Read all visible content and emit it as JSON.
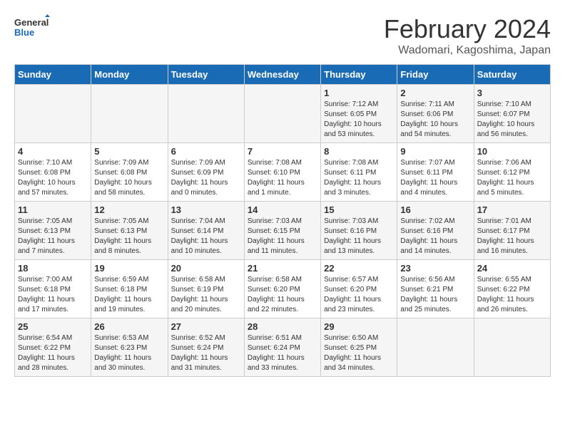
{
  "logo": {
    "line1": "General",
    "line2": "Blue"
  },
  "title": "February 2024",
  "subtitle": "Wadomari, Kagoshima, Japan",
  "days_of_week": [
    "Sunday",
    "Monday",
    "Tuesday",
    "Wednesday",
    "Thursday",
    "Friday",
    "Saturday"
  ],
  "weeks": [
    [
      {
        "day": "",
        "info": ""
      },
      {
        "day": "",
        "info": ""
      },
      {
        "day": "",
        "info": ""
      },
      {
        "day": "",
        "info": ""
      },
      {
        "day": "1",
        "info": "Sunrise: 7:12 AM\nSunset: 6:05 PM\nDaylight: 10 hours\nand 53 minutes."
      },
      {
        "day": "2",
        "info": "Sunrise: 7:11 AM\nSunset: 6:06 PM\nDaylight: 10 hours\nand 54 minutes."
      },
      {
        "day": "3",
        "info": "Sunrise: 7:10 AM\nSunset: 6:07 PM\nDaylight: 10 hours\nand 56 minutes."
      }
    ],
    [
      {
        "day": "4",
        "info": "Sunrise: 7:10 AM\nSunset: 6:08 PM\nDaylight: 10 hours\nand 57 minutes."
      },
      {
        "day": "5",
        "info": "Sunrise: 7:09 AM\nSunset: 6:08 PM\nDaylight: 10 hours\nand 58 minutes."
      },
      {
        "day": "6",
        "info": "Sunrise: 7:09 AM\nSunset: 6:09 PM\nDaylight: 11 hours\nand 0 minutes."
      },
      {
        "day": "7",
        "info": "Sunrise: 7:08 AM\nSunset: 6:10 PM\nDaylight: 11 hours\nand 1 minute."
      },
      {
        "day": "8",
        "info": "Sunrise: 7:08 AM\nSunset: 6:11 PM\nDaylight: 11 hours\nand 3 minutes."
      },
      {
        "day": "9",
        "info": "Sunrise: 7:07 AM\nSunset: 6:11 PM\nDaylight: 11 hours\nand 4 minutes."
      },
      {
        "day": "10",
        "info": "Sunrise: 7:06 AM\nSunset: 6:12 PM\nDaylight: 11 hours\nand 5 minutes."
      }
    ],
    [
      {
        "day": "11",
        "info": "Sunrise: 7:05 AM\nSunset: 6:13 PM\nDaylight: 11 hours\nand 7 minutes."
      },
      {
        "day": "12",
        "info": "Sunrise: 7:05 AM\nSunset: 6:13 PM\nDaylight: 11 hours\nand 8 minutes."
      },
      {
        "day": "13",
        "info": "Sunrise: 7:04 AM\nSunset: 6:14 PM\nDaylight: 11 hours\nand 10 minutes."
      },
      {
        "day": "14",
        "info": "Sunrise: 7:03 AM\nSunset: 6:15 PM\nDaylight: 11 hours\nand 11 minutes."
      },
      {
        "day": "15",
        "info": "Sunrise: 7:03 AM\nSunset: 6:16 PM\nDaylight: 11 hours\nand 13 minutes."
      },
      {
        "day": "16",
        "info": "Sunrise: 7:02 AM\nSunset: 6:16 PM\nDaylight: 11 hours\nand 14 minutes."
      },
      {
        "day": "17",
        "info": "Sunrise: 7:01 AM\nSunset: 6:17 PM\nDaylight: 11 hours\nand 16 minutes."
      }
    ],
    [
      {
        "day": "18",
        "info": "Sunrise: 7:00 AM\nSunset: 6:18 PM\nDaylight: 11 hours\nand 17 minutes."
      },
      {
        "day": "19",
        "info": "Sunrise: 6:59 AM\nSunset: 6:18 PM\nDaylight: 11 hours\nand 19 minutes."
      },
      {
        "day": "20",
        "info": "Sunrise: 6:58 AM\nSunset: 6:19 PM\nDaylight: 11 hours\nand 20 minutes."
      },
      {
        "day": "21",
        "info": "Sunrise: 6:58 AM\nSunset: 6:20 PM\nDaylight: 11 hours\nand 22 minutes."
      },
      {
        "day": "22",
        "info": "Sunrise: 6:57 AM\nSunset: 6:20 PM\nDaylight: 11 hours\nand 23 minutes."
      },
      {
        "day": "23",
        "info": "Sunrise: 6:56 AM\nSunset: 6:21 PM\nDaylight: 11 hours\nand 25 minutes."
      },
      {
        "day": "24",
        "info": "Sunrise: 6:55 AM\nSunset: 6:22 PM\nDaylight: 11 hours\nand 26 minutes."
      }
    ],
    [
      {
        "day": "25",
        "info": "Sunrise: 6:54 AM\nSunset: 6:22 PM\nDaylight: 11 hours\nand 28 minutes."
      },
      {
        "day": "26",
        "info": "Sunrise: 6:53 AM\nSunset: 6:23 PM\nDaylight: 11 hours\nand 30 minutes."
      },
      {
        "day": "27",
        "info": "Sunrise: 6:52 AM\nSunset: 6:24 PM\nDaylight: 11 hours\nand 31 minutes."
      },
      {
        "day": "28",
        "info": "Sunrise: 6:51 AM\nSunset: 6:24 PM\nDaylight: 11 hours\nand 33 minutes."
      },
      {
        "day": "29",
        "info": "Sunrise: 6:50 AM\nSunset: 6:25 PM\nDaylight: 11 hours\nand 34 minutes."
      },
      {
        "day": "",
        "info": ""
      },
      {
        "day": "",
        "info": ""
      }
    ]
  ]
}
